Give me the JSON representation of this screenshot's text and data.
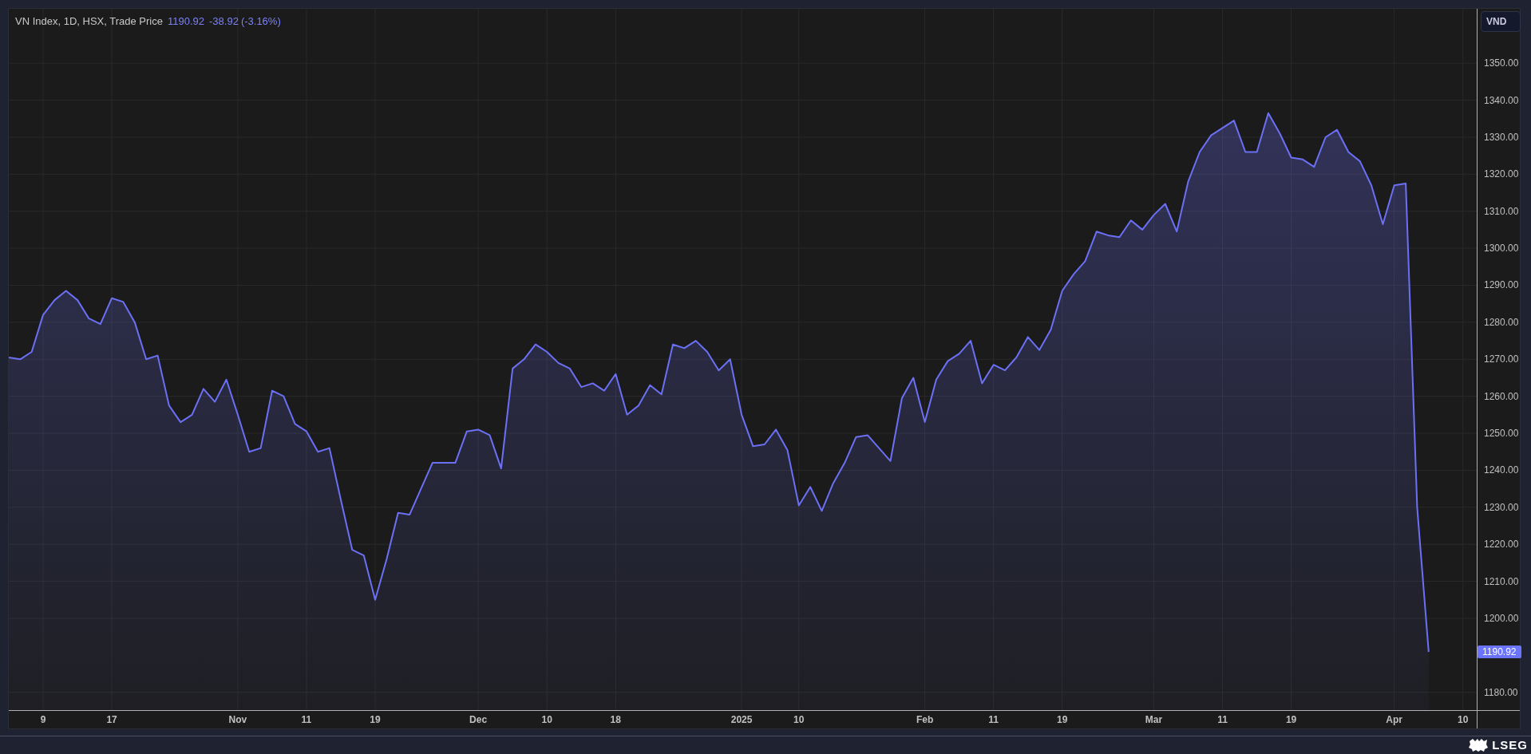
{
  "legend": {
    "label": "VN Index, 1D, HSX, Trade Price",
    "last": "1190.92",
    "change": "-38.92",
    "change_pct": "(-3.16%)"
  },
  "currency_button": "VND",
  "last_price_label": "1190.92",
  "chart_data": {
    "type": "area",
    "categories": [
      null,
      null,
      null,
      "9",
      null,
      null,
      null,
      null,
      null,
      "17",
      null,
      null,
      null,
      null,
      null,
      null,
      null,
      null,
      null,
      null,
      "Nov",
      null,
      null,
      null,
      null,
      null,
      "11",
      null,
      null,
      null,
      null,
      null,
      "19",
      null,
      null,
      null,
      null,
      null,
      null,
      null,
      null,
      "Dec",
      null,
      null,
      null,
      null,
      null,
      "10",
      null,
      null,
      null,
      null,
      null,
      "18",
      null,
      null,
      null,
      null,
      null,
      null,
      null,
      null,
      null,
      null,
      "2025",
      null,
      null,
      null,
      null,
      "10",
      null,
      null,
      null,
      null,
      null,
      null,
      null,
      null,
      null,
      null,
      "Feb",
      null,
      null,
      null,
      null,
      null,
      "11",
      null,
      null,
      null,
      null,
      null,
      "19",
      null,
      null,
      null,
      null,
      null,
      null,
      null,
      "Mar",
      null,
      null,
      null,
      null,
      null,
      "11",
      null,
      null,
      null,
      null,
      null,
      "19",
      null,
      null,
      null,
      null,
      null,
      null,
      null,
      null,
      "Apr",
      null,
      null,
      null,
      null,
      null,
      "10",
      null
    ],
    "series": [
      {
        "color": "#6b70f5",
        "values": [
          1270.5,
          1270,
          1272,
          1282,
          1286,
          1288.5,
          1286,
          1281,
          1279.5,
          1286.5,
          1285.5,
          1280,
          1270,
          1271,
          1257.5,
          1253,
          1255,
          1262,
          1258.5,
          1264.5,
          1255,
          1245,
          1246,
          1261.5,
          1260,
          1252.5,
          1250.5,
          1245,
          1246,
          1232,
          1218.5,
          1217,
          1205,
          1216,
          1228.5,
          1228,
          1235,
          1242,
          1242,
          1242,
          1250.5,
          1251,
          1249.5,
          1240.5,
          1267.5,
          1270,
          1274,
          1272,
          1269,
          1267.5,
          1262.5,
          1263.5,
          1261.5,
          1266,
          1255,
          1257.5,
          1263,
          1260.5,
          1274,
          1273,
          1275,
          1272,
          1267,
          1270,
          1255,
          1246.5,
          1247,
          1251,
          1245.5,
          1230.5,
          1235.5,
          1229,
          1236.5,
          1242,
          1249,
          1249.5,
          1246,
          1242.5,
          1259.5,
          1265,
          1253,
          1264.5,
          1269.5,
          1271.5,
          1275,
          1263.5,
          1268.5,
          1267,
          1270.5,
          1276,
          1272.5,
          1278,
          1288.5,
          1293,
          1296.5,
          1304.5,
          1303.5,
          1303,
          1307.5,
          1305,
          1309,
          1312,
          1304.5,
          1318,
          1326,
          1330.5,
          1332.5,
          1334.5,
          1326,
          1326,
          1336.5,
          1331,
          1324.5,
          1324,
          1322,
          1330,
          1332,
          1326,
          1323.5,
          1317,
          1306.5,
          1317,
          1317.5,
          1230,
          1190.9,
          null,
          null,
          null,
          null
        ]
      }
    ],
    "grid": true,
    "ylim": [
      1175.2,
      1364.7
    ],
    "yticks": [
      {
        "value": 1180,
        "label": "1180.00"
      },
      {
        "value": 1200,
        "label": "1200.00"
      },
      {
        "value": 1210,
        "label": "1210.00"
      },
      {
        "value": 1220,
        "label": "1220.00"
      },
      {
        "value": 1230,
        "label": "1230.00"
      },
      {
        "value": 1240,
        "label": "1240.00"
      },
      {
        "value": 1250,
        "label": "1250.00"
      },
      {
        "value": 1260,
        "label": "1260.00"
      },
      {
        "value": 1270,
        "label": "1270.00"
      },
      {
        "value": 1280,
        "label": "1280.00"
      },
      {
        "value": 1290,
        "label": "1290.00"
      },
      {
        "value": 1300,
        "label": "1300.00"
      },
      {
        "value": 1310,
        "label": "1310.00"
      },
      {
        "value": 1320,
        "label": "1320.00"
      },
      {
        "value": 1330,
        "label": "1330.00"
      },
      {
        "value": 1340,
        "label": "1340.00"
      },
      {
        "value": 1350,
        "label": "1350.00"
      }
    ]
  },
  "footer": {
    "logo": "LSEG"
  }
}
